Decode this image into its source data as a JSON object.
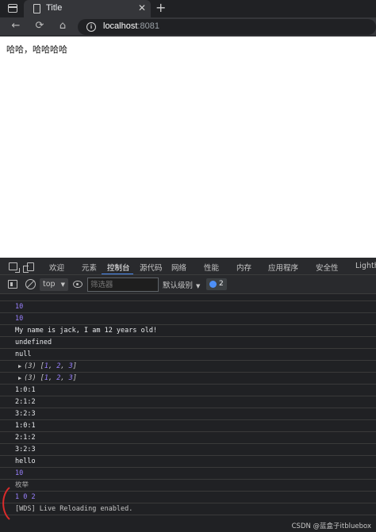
{
  "browser": {
    "tab_title": "Title",
    "tab_close": "✕",
    "new_tab": "+",
    "url_host": "localhost",
    "url_port": ":8081"
  },
  "page": {
    "text": "哈哈，哈哈哈哈"
  },
  "devtools": {
    "tabs": [
      "欢迎",
      "元素",
      "控制台",
      "源代码",
      "网络",
      "性能",
      "内存",
      "应用程序",
      "安全性",
      "Lighth"
    ],
    "active_tab": "控制台",
    "context": "top",
    "filter_placeholder": "筛选器",
    "level": "默认级别",
    "issues_count": "2"
  },
  "console": {
    "lines": [
      {
        "text": "10",
        "kind": "num"
      },
      {
        "text": "10",
        "kind": "num"
      },
      {
        "text": "My name is jack, I am 12 years old!",
        "kind": "text"
      },
      {
        "text": "undefined",
        "kind": "text"
      },
      {
        "text": "null",
        "kind": "text"
      },
      {
        "len": "(3)",
        "items": [
          "1",
          "2",
          "3"
        ],
        "kind": "arr"
      },
      {
        "len": "(3)",
        "items": [
          "1",
          "2",
          "3"
        ],
        "kind": "arr"
      },
      {
        "text": "1:0:1",
        "kind": "text"
      },
      {
        "text": "2:1:2",
        "kind": "text"
      },
      {
        "text": "3:2:3",
        "kind": "text"
      },
      {
        "text": "1:0:1",
        "kind": "text"
      },
      {
        "text": "2:1:2",
        "kind": "text"
      },
      {
        "text": "3:2:3",
        "kind": "text"
      },
      {
        "text": "hello",
        "kind": "text"
      },
      {
        "text": "10",
        "kind": "num"
      },
      {
        "text": "枚举",
        "kind": "grey"
      },
      {
        "text": "1 0 2",
        "kind": "num"
      },
      {
        "text": "[WDS] Live Reloading enabled.",
        "kind": "wds"
      }
    ]
  },
  "watermark": "CSDN @蓝盒子itbluebox",
  "colors": {
    "number": "#9980ff",
    "accent": "#4d8ff7",
    "annotation": "#d92b2b"
  }
}
